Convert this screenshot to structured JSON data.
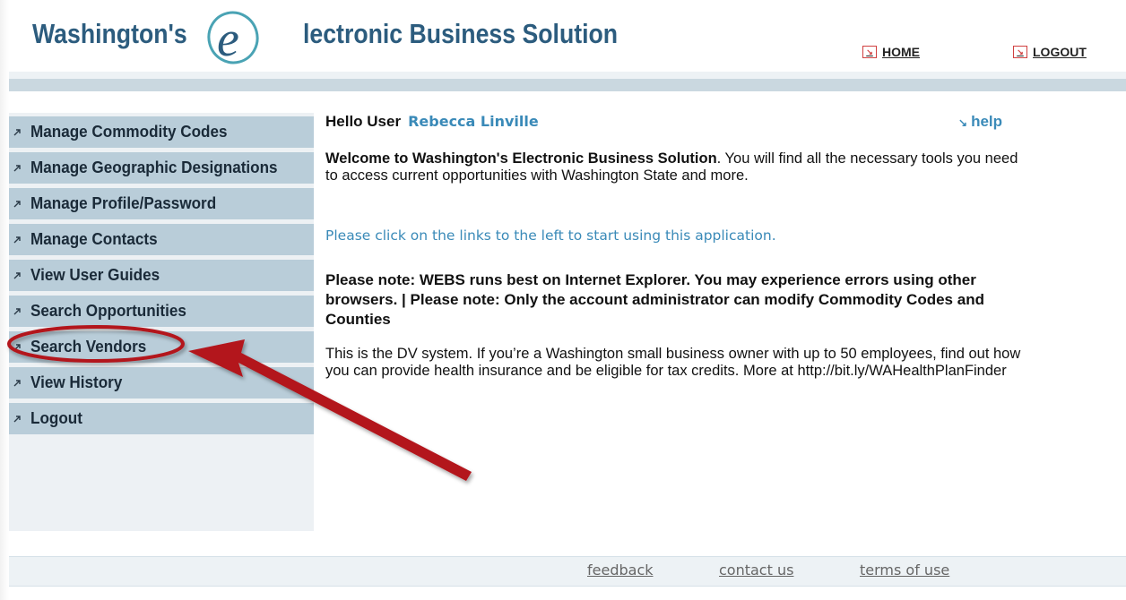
{
  "header": {
    "title_prefix": "Washington's",
    "title_rest": "lectronic Business Solution",
    "logo_letter": "e",
    "home_label": "HOME",
    "logout_label": "LOGOUT",
    "link_icon": "arrow-square-icon"
  },
  "sidebar": {
    "items": [
      {
        "label": "Manage Commodity Codes"
      },
      {
        "label": "Manage Geographic Designations"
      },
      {
        "label": "Manage Profile/Password"
      },
      {
        "label": "Manage Contacts"
      },
      {
        "label": "View User Guides"
      },
      {
        "label": "Search Opportunities"
      },
      {
        "label": "Search Vendors"
      },
      {
        "label": "View History"
      },
      {
        "label": "Logout"
      }
    ]
  },
  "main": {
    "hello_label": "Hello User",
    "user_name": "Rebecca Linville",
    "help_label": "help",
    "welcome_bold": "Welcome to Washington's Electronic Business Solution",
    "welcome_rest": ". You will find all the necessary tools you need to access current opportunities with Washington State and more.",
    "click_message": "Please click on the links to the left to start using this application.",
    "note": "Please note: WEBS runs best on Internet Explorer. You may experience errors using other browsers. | Please note: Only the account administrator can modify Commodity Codes and Counties",
    "dv_message": "This is the DV system. If you’re a Washington small business owner with up to 50 employees, find out how you can provide health insurance and be eligible for tax credits. More at http://bit.ly/WAHealthPlanFinder"
  },
  "footer": {
    "feedback": "feedback",
    "contact_us": "contact us",
    "terms_of_use": "terms of use"
  },
  "colors": {
    "brand": "#2c5c7e",
    "link_blue": "#3a8ab8",
    "nav_bg": "#b9cdd9",
    "annotation_red": "#b3121a"
  }
}
